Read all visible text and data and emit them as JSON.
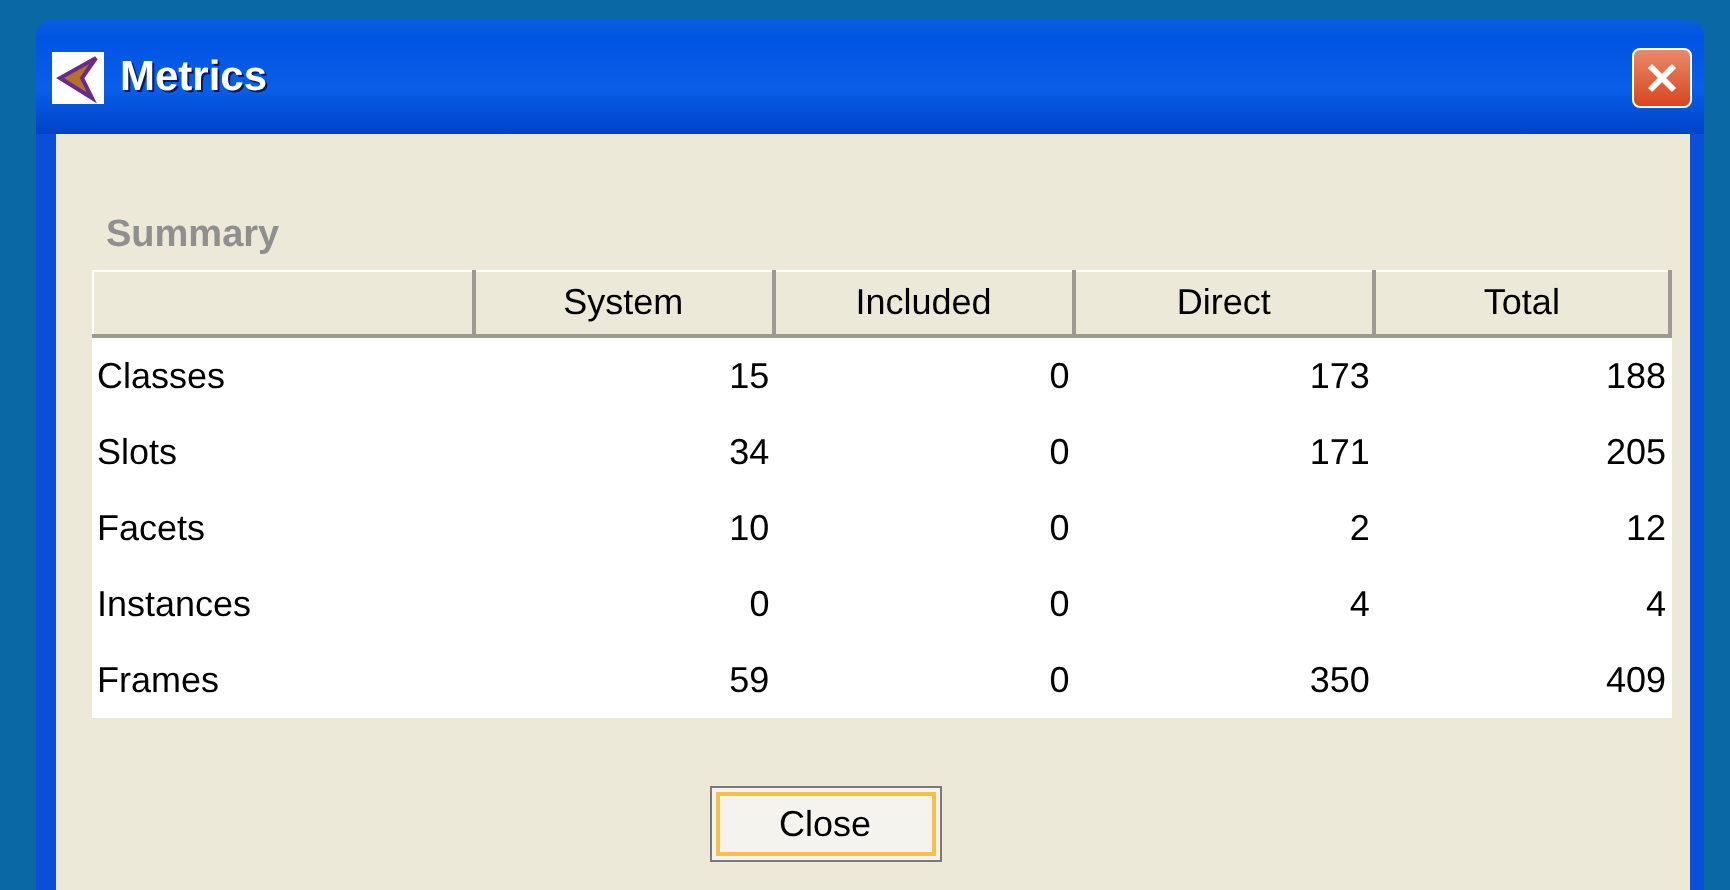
{
  "window": {
    "title": "Metrics"
  },
  "summary": {
    "label": "Summary",
    "columns": [
      "",
      "System",
      "Included",
      "Direct",
      "Total"
    ],
    "rows": [
      {
        "name": "Classes",
        "values": [
          "15",
          "0",
          "173",
          "188"
        ]
      },
      {
        "name": "Slots",
        "values": [
          "34",
          "0",
          "171",
          "205"
        ]
      },
      {
        "name": "Facets",
        "values": [
          "10",
          "0",
          "2",
          "12"
        ]
      },
      {
        "name": "Instances",
        "values": [
          "0",
          "0",
          "4",
          "4"
        ]
      },
      {
        "name": "Frames",
        "values": [
          "59",
          "0",
          "350",
          "409"
        ]
      }
    ]
  },
  "buttons": [
    {
      "label": "Close",
      "focused": true
    }
  ]
}
